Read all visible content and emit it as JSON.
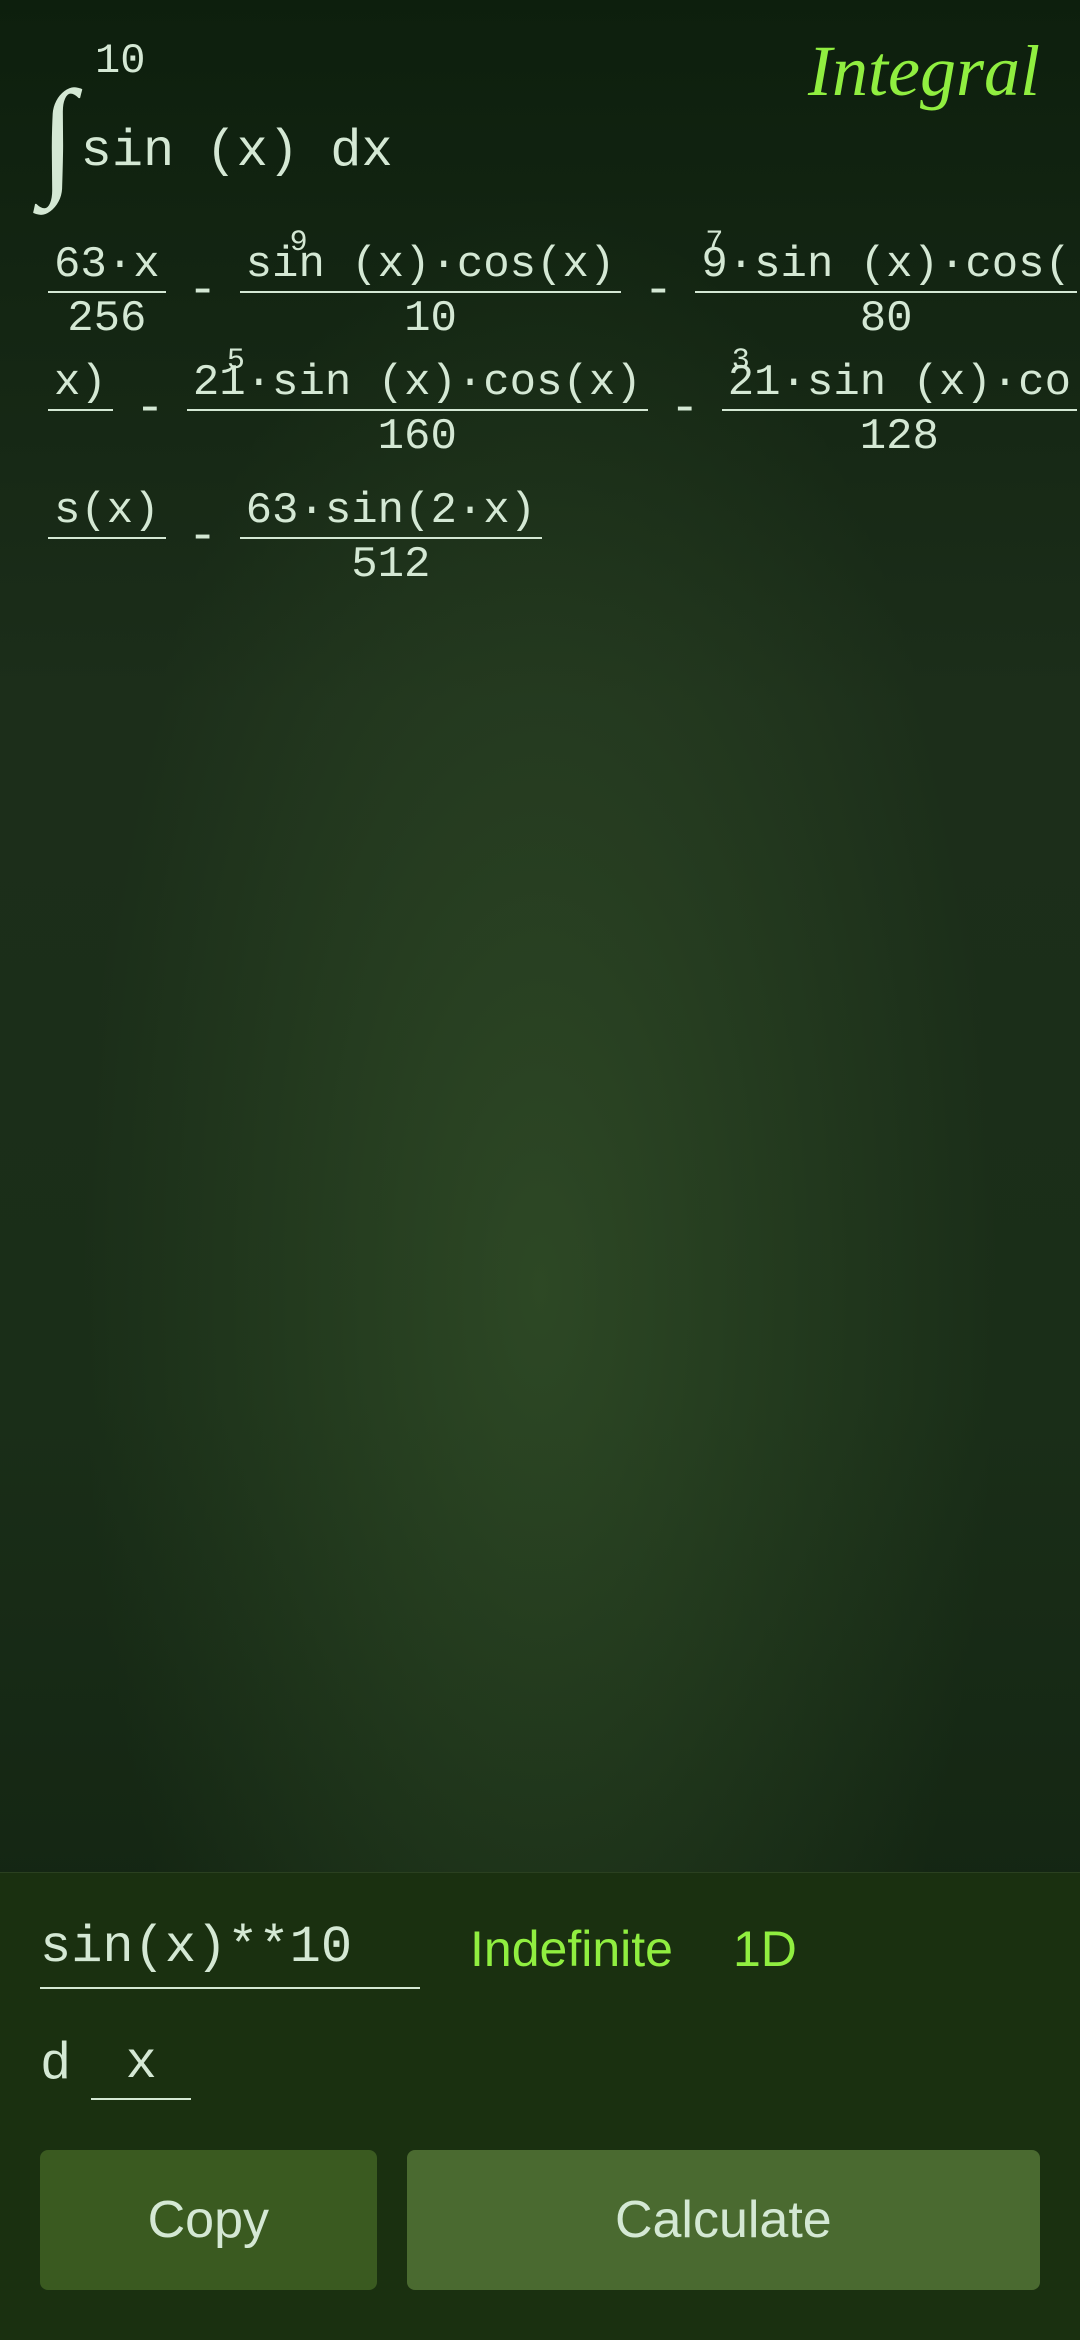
{
  "app": {
    "title": "Integral"
  },
  "integral": {
    "limit_top": "10",
    "expression": "sin  (x) dx",
    "integral_symbol": "∫"
  },
  "result": {
    "line1": {
      "term1_num": "63·x",
      "term1_den": "256",
      "op1": "-",
      "term2_sup": "9",
      "term2_num": "sin (x)·cos(x)",
      "term2_den": "10",
      "op2": "-",
      "term3_sup": "7",
      "term3_num": "9·sin (x)·cos(",
      "term3_den": "80"
    },
    "line2": {
      "term1_num": "x)",
      "term1_den": "",
      "op1": "-",
      "term2_sup": "5",
      "term2_num": "21·sin (x)·cos(x)",
      "term2_den": "160",
      "op2": "-",
      "term3_sup": "3",
      "term3_num": "21·sin (x)·co",
      "term3_den": "128"
    },
    "line3": {
      "term1_num": "s(x)",
      "term1_den": "",
      "op1": "-",
      "term2_num": "63·sin(2·x)",
      "term2_den": "512"
    }
  },
  "controls": {
    "expression_value": "sin(x)**10",
    "expression_placeholder": "sin(x)**10",
    "mode_label": "Indefinite",
    "dimension_label": "1D",
    "d_label": "d",
    "variable_value": "x",
    "copy_label": "Copy",
    "calculate_label": "Calculate"
  }
}
